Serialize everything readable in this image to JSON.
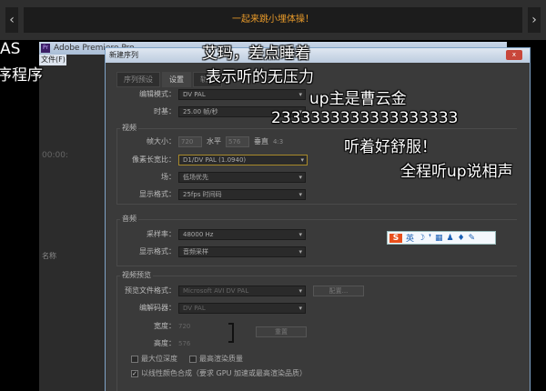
{
  "player": {
    "prev_label": "‹",
    "next_label": "›",
    "banner_text": "一起来跳小埋体操！",
    "banner_color": "#e89a2a"
  },
  "premiere": {
    "logo": "Pr",
    "title": "Adobe Premiere Pro",
    "menu_file": "文件(F)",
    "timecode": "00:00:",
    "project_col": "名称"
  },
  "dialog": {
    "title": "新建序列",
    "close": "x",
    "tabs": [
      {
        "label": "序列预设"
      },
      {
        "label": "设置"
      },
      {
        "label": "轨道"
      }
    ],
    "edit_mode": {
      "label": "编辑模式：",
      "value": "DV PAL"
    },
    "timebase": {
      "label": "时基：",
      "value": "25.00 帧/秒"
    },
    "video": {
      "group": "视频",
      "frame_size_label": "帧大小：",
      "frame_w": "720",
      "horizontal": "水平",
      "frame_h": "576",
      "vertical": "垂直",
      "aspect": "4:3",
      "pixel_aspect": {
        "label": "像素长宽比：",
        "value": "D1/DV PAL (1.0940)"
      },
      "field": {
        "label": "场：",
        "value": "低场优先"
      },
      "display_format": {
        "label": "显示格式：",
        "value": "25fps 时间码"
      }
    },
    "audio": {
      "group": "音频",
      "sample_rate": {
        "label": "采样率：",
        "value": "48000 Hz"
      },
      "display_format": {
        "label": "显示格式：",
        "value": "音频采样"
      }
    },
    "preview": {
      "group": "视频预览",
      "file_format": {
        "label": "预览文件格式：",
        "value": "Microsoft AVI DV PAL"
      },
      "configure": "配置...",
      "codec": {
        "label": "编解码器：",
        "value": "DV PAL"
      },
      "width_label": "宽度：",
      "width": "720",
      "height_label": "高度：",
      "height": "576",
      "reset": "重置"
    },
    "max_bit_depth": {
      "label": "最大位深度",
      "checked": false
    },
    "max_render": {
      "label": "最高渲染质量",
      "checked": false
    },
    "linear_color": {
      "label": "以线性颜色合成（要求 GPU 加速或最高渲染品质）",
      "checked": true
    }
  },
  "danmaku": [
    "AS",
    "序程序",
    "艾玛，差点睡着",
    "表示听的无压力",
    "up主是曹云金",
    "2333333333333333333",
    "听着好舒服！",
    "全程听up说相声"
  ],
  "ime": {
    "logo": "S",
    "mode": "英"
  }
}
